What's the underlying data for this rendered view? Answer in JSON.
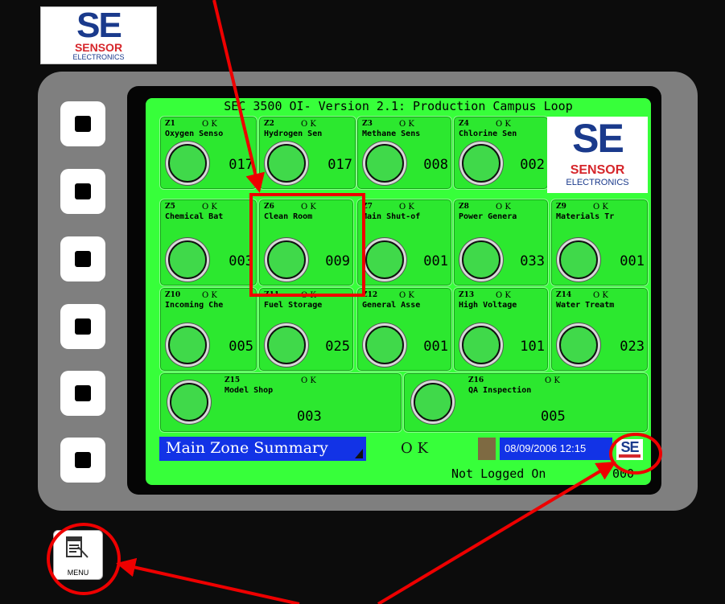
{
  "brand": {
    "logo_letters": "SE",
    "logo_word": "SENSOR",
    "logo_sub": "ELECTRONICS",
    "colors": {
      "blue": "#1a3a8c",
      "red": "#d6262b"
    }
  },
  "screen": {
    "title": "SEC 3500 OI- Version 2.1: Production Campus Loop",
    "background_color": "#37ff3a",
    "zones": [
      {
        "id": "Z1",
        "status": "O K",
        "name": "Oxygen Senso",
        "value": "017"
      },
      {
        "id": "Z2",
        "status": "O K",
        "name": "Hydrogen Sen",
        "value": "017"
      },
      {
        "id": "Z3",
        "status": "O K",
        "name": "Methane Sens",
        "value": "008"
      },
      {
        "id": "Z4",
        "status": "O K",
        "name": "Chlorine Sen",
        "value": "002"
      },
      {
        "id": "Z5",
        "status": "O K",
        "name": "Chemical Bat",
        "value": "003"
      },
      {
        "id": "Z6",
        "status": "O K",
        "name": "Clean Room",
        "value": "009"
      },
      {
        "id": "Z7",
        "status": "O K",
        "name": "Main Shut-of",
        "value": "001"
      },
      {
        "id": "Z8",
        "status": "O K",
        "name": "Power Genera",
        "value": "033"
      },
      {
        "id": "Z9",
        "status": "O K",
        "name": "Materials Tr",
        "value": "001"
      },
      {
        "id": "Z10",
        "status": "O K",
        "name": "Incoming Che",
        "value": "005"
      },
      {
        "id": "Z11",
        "status": "O K",
        "name": "Fuel Storage",
        "value": "025"
      },
      {
        "id": "Z12",
        "status": "O K",
        "name": "General Asse",
        "value": "001"
      },
      {
        "id": "Z13",
        "status": "O K",
        "name": "High Voltage",
        "value": "101"
      },
      {
        "id": "Z14",
        "status": "O K",
        "name": "Water Treatm",
        "value": "023"
      },
      {
        "id": "Z15",
        "status": "O K",
        "name": "Model Shop",
        "value": "003"
      },
      {
        "id": "Z16",
        "status": "O K",
        "name": "QA Inspection",
        "value": "005"
      }
    ],
    "footer": {
      "mode_label": "Main Zone Summary",
      "system_status": "O K",
      "datetime": "08/09/2006 12:15",
      "mini_logo": "SE",
      "user_status": "Not Logged On",
      "user_code": "000"
    }
  },
  "menu": {
    "label": "MENU",
    "icon": "menu-document-icon"
  },
  "annotations": {
    "color": "#ee0000"
  }
}
